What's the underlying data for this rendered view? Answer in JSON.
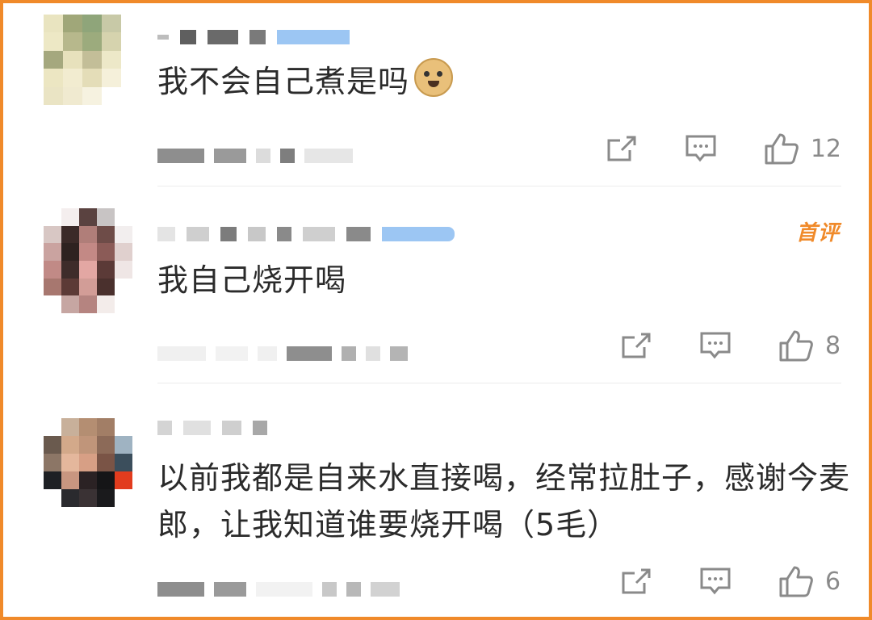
{
  "comments": [
    {
      "text": "我不会自己煮是吗",
      "emoji_icon": "doge-emoji-icon",
      "like_count": "12",
      "badge": ""
    },
    {
      "text": "我自己烧开喝",
      "like_count": "8",
      "badge": "首评"
    },
    {
      "text": "以前我都是自来水直接喝，经常拉肚子，感谢今麦郎，让我知道谁要烧开喝（5毛）",
      "like_count": "6",
      "badge": ""
    }
  ],
  "icons": {
    "share": "share-icon",
    "reply": "comment-icon",
    "like": "thumb-up-icon"
  },
  "colors": {
    "frame": "#f08a2a",
    "badge": "#f08a2a",
    "text": "#2b2b2b",
    "icon": "#8a8a8a"
  }
}
